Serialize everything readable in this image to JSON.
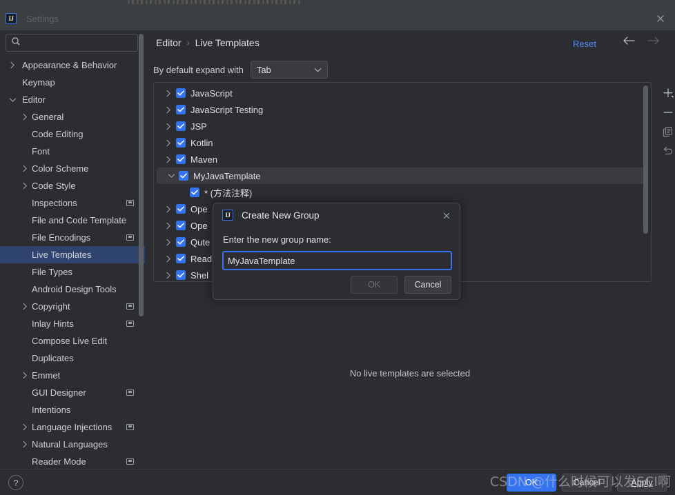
{
  "window": {
    "title": "Settings",
    "logo_text": "IJ",
    "close_icon": "close-icon"
  },
  "search": {
    "value": "",
    "placeholder": "",
    "icon": "search-icon"
  },
  "sidebar": {
    "items": [
      {
        "label": "Appearance & Behavior",
        "indent": 0,
        "arrow": "chevron-right",
        "badge": false,
        "selected": false
      },
      {
        "label": "Keymap",
        "indent": 0,
        "arrow": "",
        "badge": false,
        "selected": false
      },
      {
        "label": "Editor",
        "indent": 0,
        "arrow": "chevron-down",
        "badge": false,
        "selected": false
      },
      {
        "label": "General",
        "indent": 1,
        "arrow": "chevron-right",
        "badge": false,
        "selected": false
      },
      {
        "label": "Code Editing",
        "indent": 1,
        "arrow": "",
        "badge": false,
        "selected": false
      },
      {
        "label": "Font",
        "indent": 1,
        "arrow": "",
        "badge": false,
        "selected": false
      },
      {
        "label": "Color Scheme",
        "indent": 1,
        "arrow": "chevron-right",
        "badge": false,
        "selected": false
      },
      {
        "label": "Code Style",
        "indent": 1,
        "arrow": "chevron-right",
        "badge": false,
        "selected": false
      },
      {
        "label": "Inspections",
        "indent": 1,
        "arrow": "",
        "badge": true,
        "selected": false
      },
      {
        "label": "File and Code Template",
        "indent": 1,
        "arrow": "",
        "badge": false,
        "selected": false
      },
      {
        "label": "File Encodings",
        "indent": 1,
        "arrow": "",
        "badge": true,
        "selected": false
      },
      {
        "label": "Live Templates",
        "indent": 1,
        "arrow": "",
        "badge": false,
        "selected": true
      },
      {
        "label": "File Types",
        "indent": 1,
        "arrow": "",
        "badge": false,
        "selected": false
      },
      {
        "label": "Android Design Tools",
        "indent": 1,
        "arrow": "",
        "badge": false,
        "selected": false
      },
      {
        "label": "Copyright",
        "indent": 1,
        "arrow": "chevron-right",
        "badge": true,
        "selected": false
      },
      {
        "label": "Inlay Hints",
        "indent": 1,
        "arrow": "",
        "badge": true,
        "selected": false
      },
      {
        "label": "Compose Live Edit",
        "indent": 1,
        "arrow": "",
        "badge": false,
        "selected": false
      },
      {
        "label": "Duplicates",
        "indent": 1,
        "arrow": "",
        "badge": false,
        "selected": false
      },
      {
        "label": "Emmet",
        "indent": 1,
        "arrow": "chevron-right",
        "badge": false,
        "selected": false
      },
      {
        "label": "GUI Designer",
        "indent": 1,
        "arrow": "",
        "badge": true,
        "selected": false
      },
      {
        "label": "Intentions",
        "indent": 1,
        "arrow": "",
        "badge": false,
        "selected": false
      },
      {
        "label": "Language Injections",
        "indent": 1,
        "arrow": "chevron-right",
        "badge": true,
        "selected": false
      },
      {
        "label": "Natural Languages",
        "indent": 1,
        "arrow": "chevron-right",
        "badge": false,
        "selected": false
      },
      {
        "label": "Reader Mode",
        "indent": 1,
        "arrow": "",
        "badge": true,
        "selected": false
      }
    ]
  },
  "header": {
    "breadcrumb": [
      "Editor",
      "Live Templates"
    ],
    "separator": "›",
    "reset_label": "Reset",
    "back_icon": "arrow-left-icon",
    "forward_icon": "arrow-right-icon"
  },
  "options": {
    "expand_label": "By default expand with",
    "expand_value": "Tab"
  },
  "templates": {
    "rows": [
      {
        "label": "JavaScript",
        "arrow": "chevron-right",
        "checked": true,
        "selected": false,
        "child": false
      },
      {
        "label": "JavaScript Testing",
        "arrow": "chevron-right",
        "checked": true,
        "selected": false,
        "child": false
      },
      {
        "label": "JSP",
        "arrow": "chevron-right",
        "checked": true,
        "selected": false,
        "child": false
      },
      {
        "label": "Kotlin",
        "arrow": "chevron-right",
        "checked": true,
        "selected": false,
        "child": false
      },
      {
        "label": "Maven",
        "arrow": "chevron-right",
        "checked": true,
        "selected": false,
        "child": false
      },
      {
        "label": "MyJavaTemplate",
        "arrow": "chevron-down",
        "checked": true,
        "selected": true,
        "child": false
      },
      {
        "label": "* (方法注释)",
        "arrow": "",
        "checked": true,
        "selected": false,
        "child": true
      },
      {
        "label": "Ope",
        "arrow": "chevron-right",
        "checked": true,
        "selected": false,
        "child": false
      },
      {
        "label": "Ope",
        "arrow": "chevron-right",
        "checked": true,
        "selected": false,
        "child": false
      },
      {
        "label": "Qute",
        "arrow": "chevron-right",
        "checked": true,
        "selected": false,
        "child": false
      },
      {
        "label": "Read",
        "arrow": "chevron-right",
        "checked": true,
        "selected": false,
        "child": false
      },
      {
        "label": "Shel",
        "arrow": "chevron-right",
        "checked": true,
        "selected": false,
        "child": false
      }
    ],
    "actions": [
      {
        "name": "add-template-button",
        "icon": "plus-icon"
      },
      {
        "name": "remove-template-button",
        "icon": "minus-icon"
      },
      {
        "name": "duplicate-template-button",
        "icon": "copy-icon"
      },
      {
        "name": "revert-template-button",
        "icon": "revert-icon"
      }
    ],
    "empty_message": "No live templates are selected"
  },
  "dialog": {
    "logo_text": "IJ",
    "title": "Create New Group",
    "prompt": "Enter the new group name:",
    "input_value": "MyJavaTemplate",
    "ok_label": "OK",
    "cancel_label": "Cancel",
    "close_icon": "close-icon"
  },
  "footer": {
    "help_label": "?",
    "ok_label": "OK",
    "cancel_label": "Cancel",
    "apply_label": "Apply"
  },
  "watermark": {
    "text": "CSDN @什么时候可以发SCI啊"
  },
  "colors": {
    "accent_blue": "#3574f0",
    "link_blue": "#548af7",
    "selection_blue": "#2e436e",
    "panel_bg": "#2b2d30",
    "titlebar_bg": "#3c3f41",
    "row_selected": "#393b40"
  }
}
